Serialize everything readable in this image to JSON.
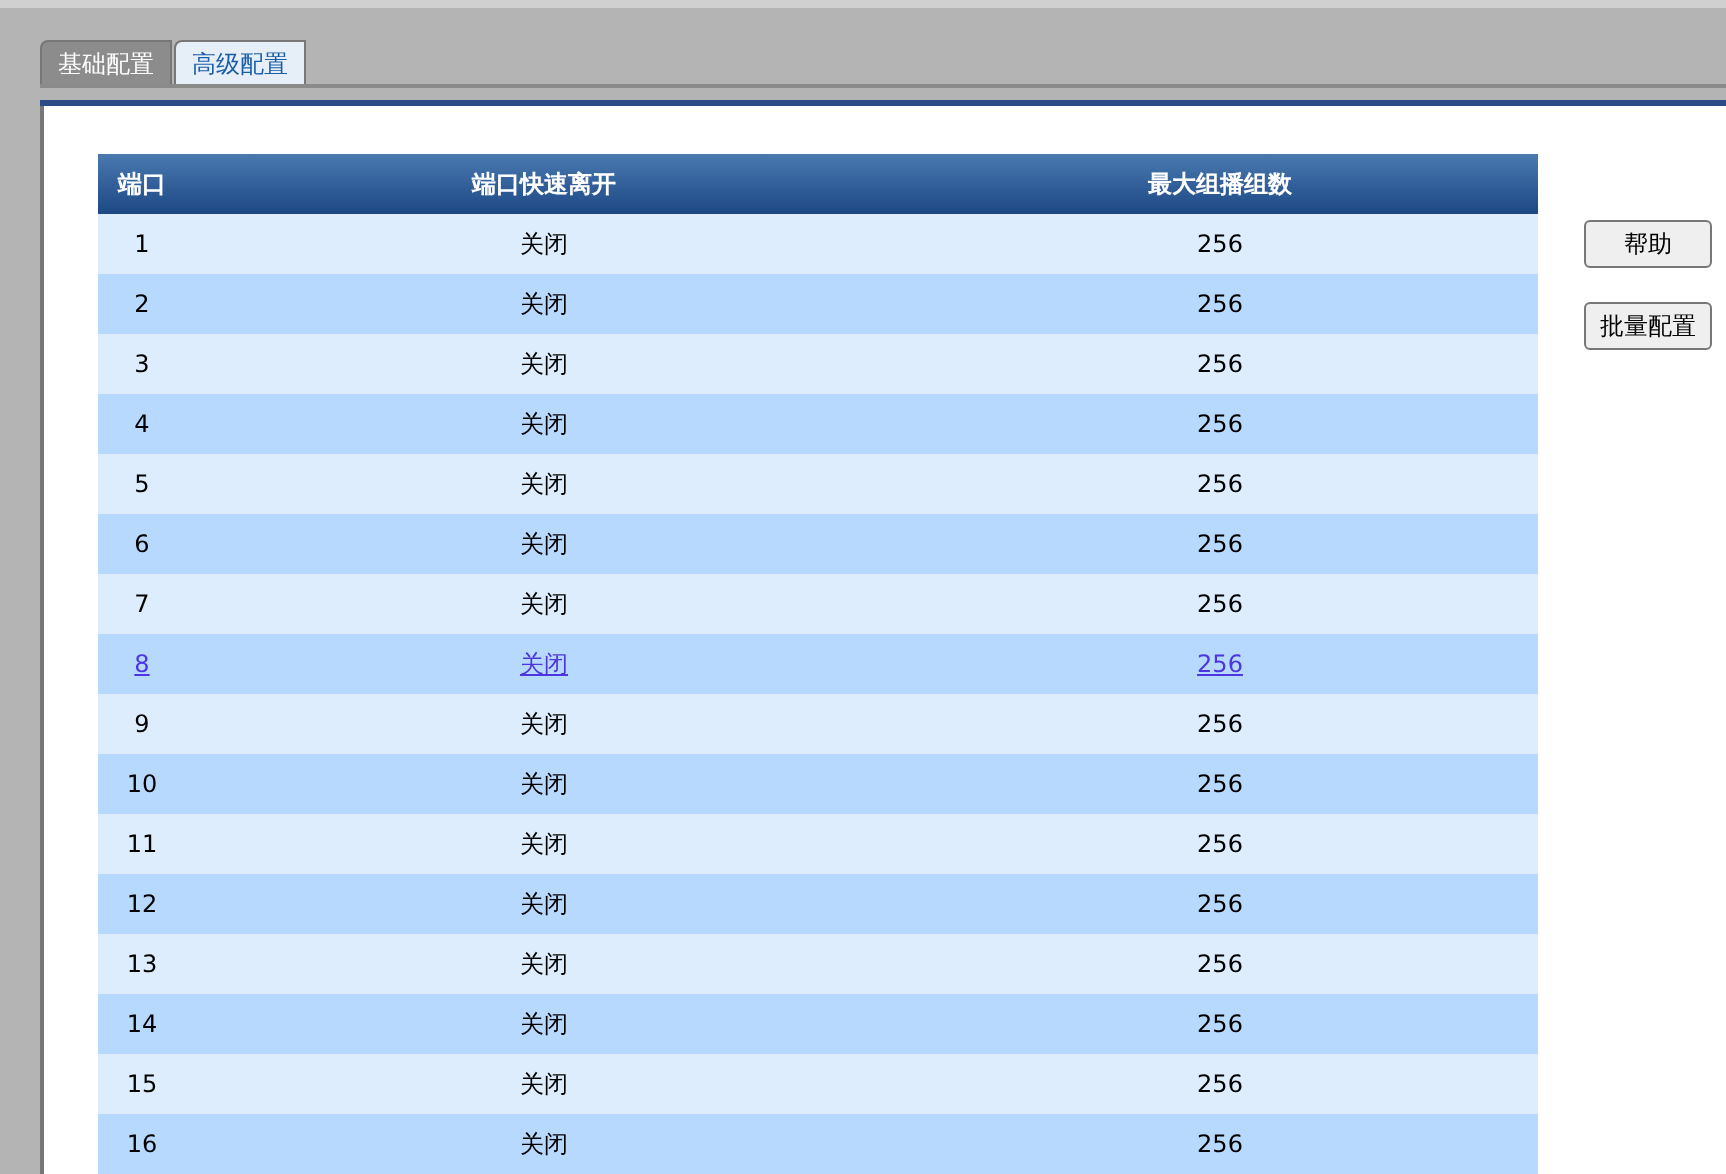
{
  "tabs": [
    {
      "label": "基础配置",
      "selected": false
    },
    {
      "label": "高级配置",
      "selected": true
    }
  ],
  "table": {
    "columns": [
      "端口",
      "端口快速离开",
      "最大组播组数"
    ],
    "rows": [
      {
        "cells": [
          "1",
          "关闭",
          "256"
        ],
        "hovered": false
      },
      {
        "cells": [
          "2",
          "关闭",
          "256"
        ],
        "hovered": false
      },
      {
        "cells": [
          "3",
          "关闭",
          "256"
        ],
        "hovered": false
      },
      {
        "cells": [
          "4",
          "关闭",
          "256"
        ],
        "hovered": false
      },
      {
        "cells": [
          "5",
          "关闭",
          "256"
        ],
        "hovered": false
      },
      {
        "cells": [
          "6",
          "关闭",
          "256"
        ],
        "hovered": false
      },
      {
        "cells": [
          "7",
          "关闭",
          "256"
        ],
        "hovered": false
      },
      {
        "cells": [
          "8",
          "关闭",
          "256"
        ],
        "hovered": true
      },
      {
        "cells": [
          "9",
          "关闭",
          "256"
        ],
        "hovered": false
      },
      {
        "cells": [
          "10",
          "关闭",
          "256"
        ],
        "hovered": false
      },
      {
        "cells": [
          "11",
          "关闭",
          "256"
        ],
        "hovered": false
      },
      {
        "cells": [
          "12",
          "关闭",
          "256"
        ],
        "hovered": false
      },
      {
        "cells": [
          "13",
          "关闭",
          "256"
        ],
        "hovered": false
      },
      {
        "cells": [
          "14",
          "关闭",
          "256"
        ],
        "hovered": false
      },
      {
        "cells": [
          "15",
          "关闭",
          "256"
        ],
        "hovered": false
      },
      {
        "cells": [
          "16",
          "关闭",
          "256"
        ],
        "hovered": false
      }
    ]
  },
  "buttons": [
    "帮助",
    "批量配置"
  ]
}
